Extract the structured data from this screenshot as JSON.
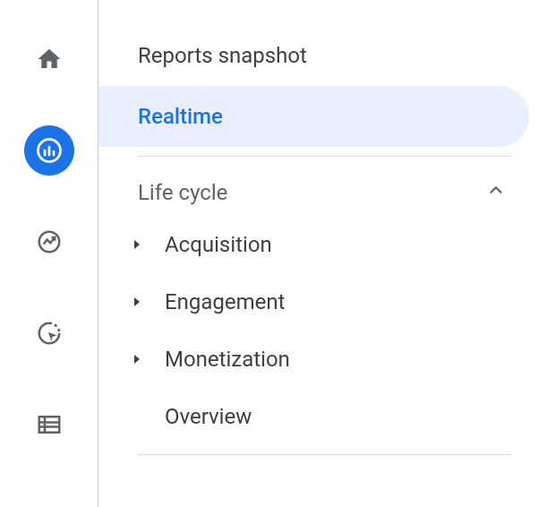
{
  "nav_rail": {
    "items": [
      {
        "name": "home",
        "active": false
      },
      {
        "name": "reports",
        "active": true
      },
      {
        "name": "explore",
        "active": false
      },
      {
        "name": "advertising",
        "active": false
      },
      {
        "name": "configure",
        "active": false
      }
    ]
  },
  "sidebar": {
    "items": [
      {
        "label": "Reports snapshot",
        "selected": false
      },
      {
        "label": "Realtime",
        "selected": true
      }
    ],
    "section": {
      "title": "Life cycle",
      "expanded": true,
      "items": [
        {
          "label": "Acquisition",
          "expandable": true
        },
        {
          "label": "Engagement",
          "expandable": true
        },
        {
          "label": "Monetization",
          "expandable": true
        },
        {
          "label": "Overview",
          "expandable": false
        }
      ]
    }
  }
}
